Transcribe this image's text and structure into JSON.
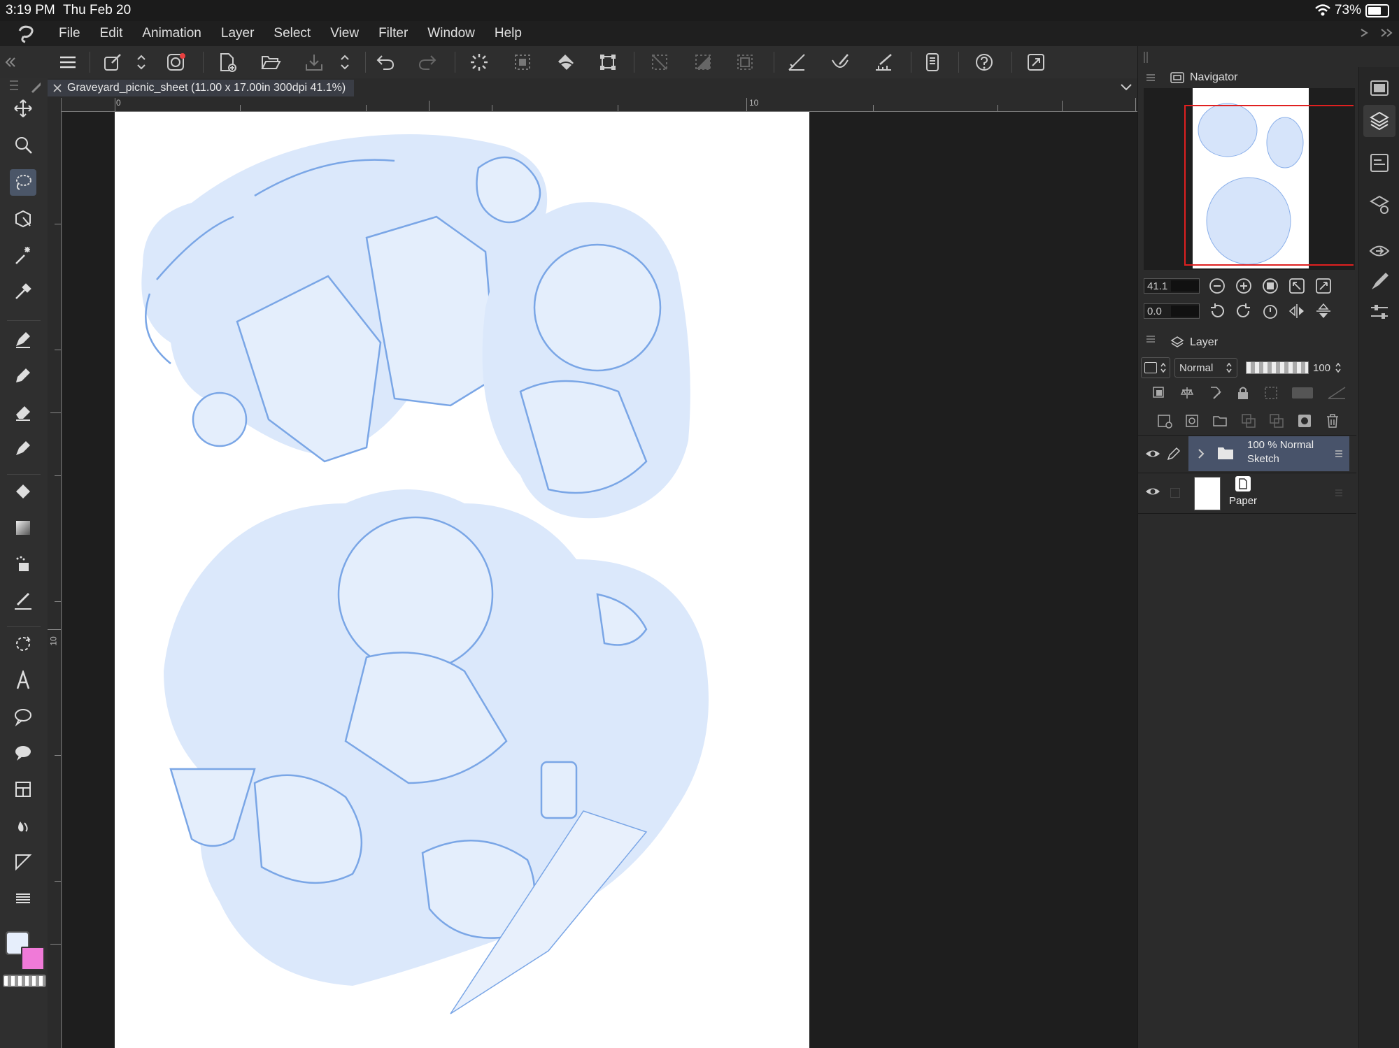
{
  "status": {
    "time": "3:19 PM",
    "date": "Thu Feb 20",
    "battery": "73%"
  },
  "menu": [
    "File",
    "Edit",
    "Animation",
    "Layer",
    "Select",
    "View",
    "Filter",
    "Window",
    "Help"
  ],
  "document_tab": {
    "title": "Graveyard_picnic_sheet (11.00 x 17.00in 300dpi 41.1%)"
  },
  "rulers": {
    "h_labels": [
      "0",
      "10"
    ],
    "v_label": "10"
  },
  "navigator": {
    "title": "Navigator",
    "zoom": "41.1",
    "rotation": "0.0"
  },
  "layer_panel": {
    "title": "Layer",
    "blend_mode": "Normal",
    "opacity": "100",
    "layers": [
      {
        "line1": "100 % Normal",
        "line2": "Sketch",
        "type": "folder",
        "selected": true
      },
      {
        "line1": "Paper",
        "type": "paper",
        "selected": false
      }
    ]
  },
  "colors": {
    "main": "#e6eefb",
    "sub": "#f07ad8",
    "accent": "#4b5668",
    "sketch": "#6a9ae4",
    "sketch_fill": "#dbe8fb"
  }
}
